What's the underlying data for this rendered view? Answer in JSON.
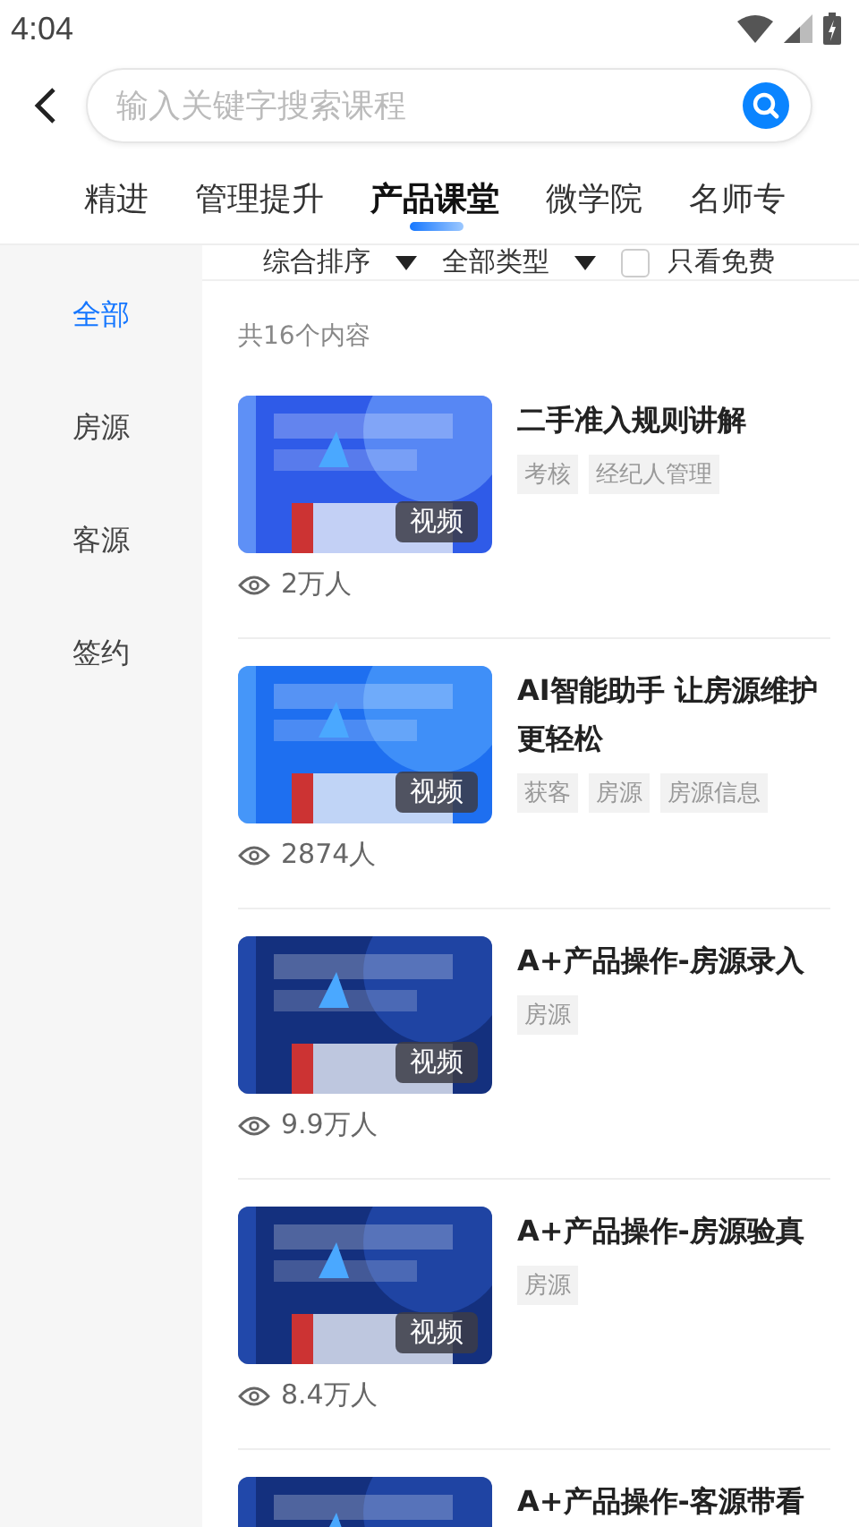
{
  "status_bar": {
    "time": "4:04"
  },
  "search": {
    "placeholder": "输入关键字搜索课程"
  },
  "tabs": [
    {
      "label": "精进",
      "selected": false
    },
    {
      "label": "管理提升",
      "selected": false
    },
    {
      "label": "产品课堂",
      "selected": true
    },
    {
      "label": "微学院",
      "selected": false
    },
    {
      "label": "名师专",
      "selected": false
    }
  ],
  "sidebar": {
    "items": [
      {
        "label": "全部",
        "selected": true
      },
      {
        "label": "房源",
        "selected": false
      },
      {
        "label": "客源",
        "selected": false
      },
      {
        "label": "签约",
        "selected": false
      }
    ]
  },
  "filters": {
    "sort": "综合排序",
    "type": "全部类型",
    "free_only": {
      "label": "只看免费",
      "checked": false
    }
  },
  "count": "共16个内容",
  "courses": [
    {
      "title": "二手准入规则讲解",
      "tags": [
        "考核",
        "经纪人管理"
      ],
      "badge": "视频",
      "views": "2万人",
      "thumb": {
        "kind": "picture"
      }
    },
    {
      "title": "AI智能助手 让房源维护更轻松",
      "tags": [
        "获客",
        "房源",
        "房源信息"
      ],
      "badge": "视频",
      "views": "2874人",
      "thumb": {
        "kind": "picture"
      }
    },
    {
      "title": "A+产品操作-房源录入",
      "tags": [
        "房源"
      ],
      "badge": "视频",
      "views": "9.9万人",
      "thumb": {
        "kind": "picture"
      }
    },
    {
      "title": "A+产品操作-房源验真",
      "tags": [
        "房源"
      ],
      "badge": "视频",
      "views": "8.4万人",
      "thumb": {
        "kind": "picture"
      }
    },
    {
      "title": "A+产品操作-客源带看",
      "thumb": {
        "kind": "picture"
      }
    }
  ]
}
